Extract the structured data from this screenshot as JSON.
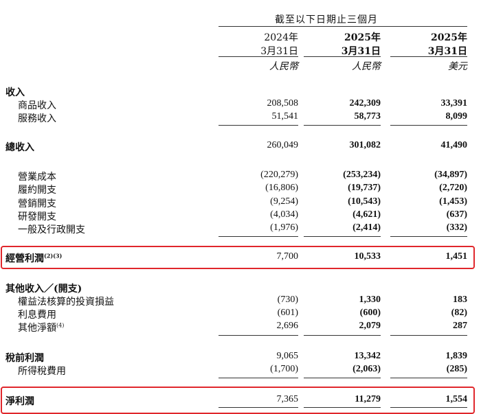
{
  "header": {
    "period_title": "截至以下日期止三個月",
    "columns": [
      {
        "year": "2024年",
        "date": "3月31日",
        "currency": "人民幣"
      },
      {
        "year": "2025年",
        "date": "3月31日",
        "currency": "人民幣"
      },
      {
        "year": "2025年",
        "date": "3月31日",
        "currency": "美元"
      }
    ]
  },
  "rows": {
    "revenue_head": {
      "label": "收入"
    },
    "goods": {
      "label": "商品收入",
      "v": [
        "208,508",
        "242,309",
        "33,391"
      ]
    },
    "services": {
      "label": "服務收入",
      "v": [
        "51,541",
        "58,773",
        "8,099"
      ]
    },
    "total_revenue": {
      "label": "總收入",
      "v": [
        "260,049",
        "301,082",
        "41,490"
      ]
    },
    "cost": {
      "label": "營業成本",
      "v": [
        "(220,279)",
        "(253,234)",
        "(34,897)"
      ]
    },
    "fulfillment": {
      "label": "履約開支",
      "v": [
        "(16,806)",
        "(19,737)",
        "(2,720)"
      ]
    },
    "marketing": {
      "label": "營銷開支",
      "v": [
        "(9,254)",
        "(10,543)",
        "(1,453)"
      ]
    },
    "rnd": {
      "label": "研發開支",
      "v": [
        "(4,034)",
        "(4,621)",
        "(637)"
      ]
    },
    "ga": {
      "label": "一般及行政開支",
      "v": [
        "(1,976)",
        "(2,414)",
        "(332)"
      ]
    },
    "operating_profit": {
      "label": "經營利潤",
      "sup": "(2)(3)",
      "v": [
        "7,700",
        "10,533",
        "1,451"
      ]
    },
    "other_head": {
      "label": "其他收入／(開支)"
    },
    "equity": {
      "label": "權益法核算的投資損益",
      "v": [
        "(730)",
        "1,330",
        "183"
      ]
    },
    "interest": {
      "label": "利息費用",
      "v": [
        "(601)",
        "(600)",
        "(82)"
      ]
    },
    "other_net": {
      "label": "其他淨額",
      "sup": "(4)",
      "v": [
        "2,696",
        "2,079",
        "287"
      ]
    },
    "pretax": {
      "label": "稅前利潤",
      "v": [
        "9,065",
        "13,342",
        "1,839"
      ]
    },
    "tax": {
      "label": "所得稅費用",
      "v": [
        "(1,700)",
        "(2,063)",
        "(285)"
      ]
    },
    "net_profit": {
      "label": "淨利潤",
      "v": [
        "7,365",
        "11,279",
        "1,554"
      ]
    }
  },
  "colors": {
    "highlight": "#e0262b"
  }
}
